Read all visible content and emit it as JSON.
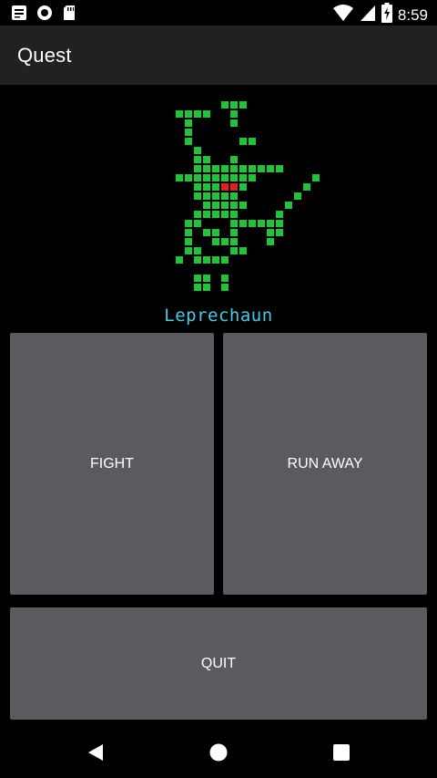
{
  "status_bar": {
    "time": "8:59",
    "icons": [
      "notification-icon",
      "record-icon",
      "sd-card-icon",
      "wifi-icon",
      "signal-icon",
      "battery-charging-icon"
    ]
  },
  "app_bar": {
    "title": "Quest"
  },
  "monster": {
    "name": "Leprechaun",
    "body_color": "#22c33a",
    "eye_color": "#e02020",
    "sprite_rows": [
      ".....XXX.....",
      "XXXX..X.....",
      ".X....X.....",
      ".X..........",
      ".X.....XX...",
      "..X..........",
      "..XX..X.....",
      "..XXXXXXXXXX",
      "XXXXXXXXX....",
      "..XXXRRX.....",
      "..XXXXX.....",
      "...XXXXX.....",
      "..XXXXX......",
      ".XX...XXXXXX",
      ".X.XX.X...XX",
      ".X..XXX...X.",
      ".XX...XX.....",
      "X.XXXX......",
      "............",
      "..XX.X.......",
      "..XX.X......."
    ]
  },
  "buttons": {
    "fight": "FIGHT",
    "run_away": "RUN AWAY",
    "quit": "QUIT"
  },
  "nav_bar": {
    "icons": [
      "back-icon",
      "home-icon",
      "recents-icon"
    ]
  }
}
